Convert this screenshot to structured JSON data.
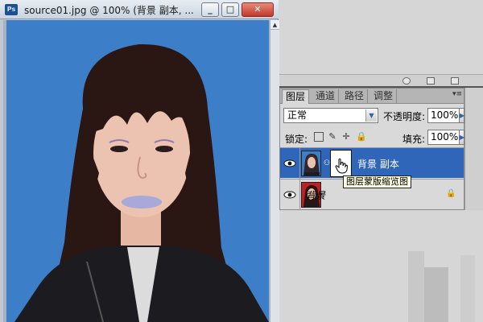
{
  "document": {
    "title": "source01.jpg @ 100% (背景 副本, ...",
    "app_icon": "Ps",
    "buttons": {
      "minimize": "_",
      "maximize": "□",
      "close": "✕"
    }
  },
  "layers_panel": {
    "tabs": [
      "图层",
      "通道",
      "路径",
      "调整"
    ],
    "active_tab": "图层",
    "blend_mode": "正常",
    "opacity_label": "不透明度:",
    "opacity_value": "100%",
    "lock_label": "锁定:",
    "fill_label": "填充:",
    "fill_value": "100%",
    "layers": [
      {
        "name": "背景 副本",
        "selected": true,
        "has_mask": true
      },
      {
        "name": "背景",
        "selected": false,
        "locked": true
      }
    ],
    "tooltip": "图层蒙版缩览图"
  },
  "colors": {
    "selection": "#3066b9",
    "photo_background": "#3d7ec9"
  },
  "icons": {
    "eye": "eye-icon",
    "lock": "lock-icon",
    "chain": "chain-link-icon",
    "hand_cursor": "hand-cursor-icon"
  }
}
